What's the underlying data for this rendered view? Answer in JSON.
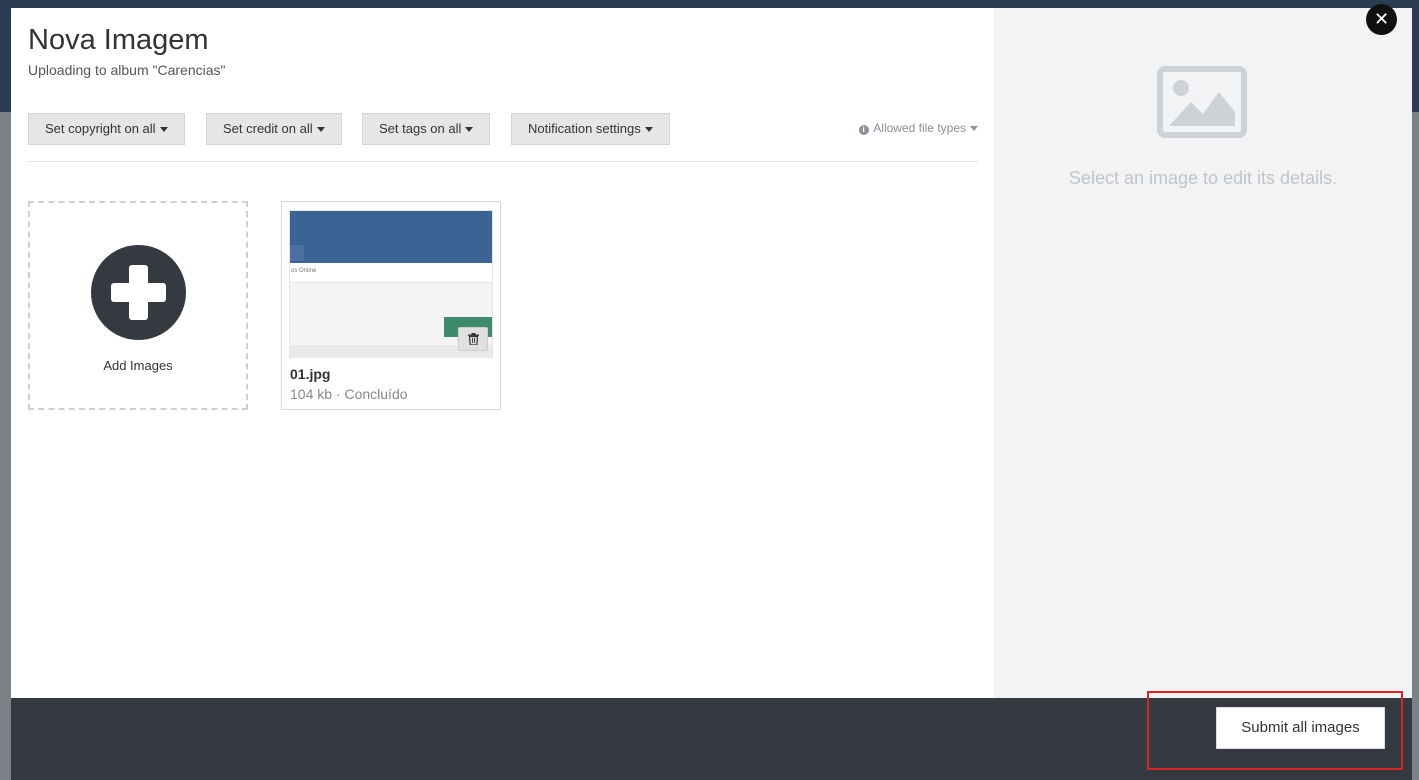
{
  "header": {
    "title": "Nova Imagem",
    "subtitle": "Uploading to album \"Carencias\""
  },
  "toolbar": {
    "copyright_label": "Set copyright on all",
    "credit_label": "Set credit on all",
    "tags_label": "Set tags on all",
    "notification_label": "Notification settings",
    "allowed_types_label": "Allowed file types"
  },
  "upload": {
    "add_label": "Add Images",
    "files": [
      {
        "name": "01.jpg",
        "meta": "104 kb · Concluído",
        "thumb_caption": "os Online"
      }
    ]
  },
  "side_panel": {
    "hint": "Select an image to edit its details."
  },
  "footer": {
    "submit_label": "Submit all images"
  },
  "colors": {
    "accent_dark": "#343a40",
    "highlight_frame": "#dd2222",
    "thumb_blue": "#3b6495",
    "thumb_green": "#3f8a6b"
  },
  "icons": {
    "close": "close-icon",
    "plus": "plus-circle-icon",
    "trash": "trash-icon",
    "info": "info-icon",
    "image_placeholder": "image-placeholder-icon",
    "caret": "caret-down-icon"
  }
}
